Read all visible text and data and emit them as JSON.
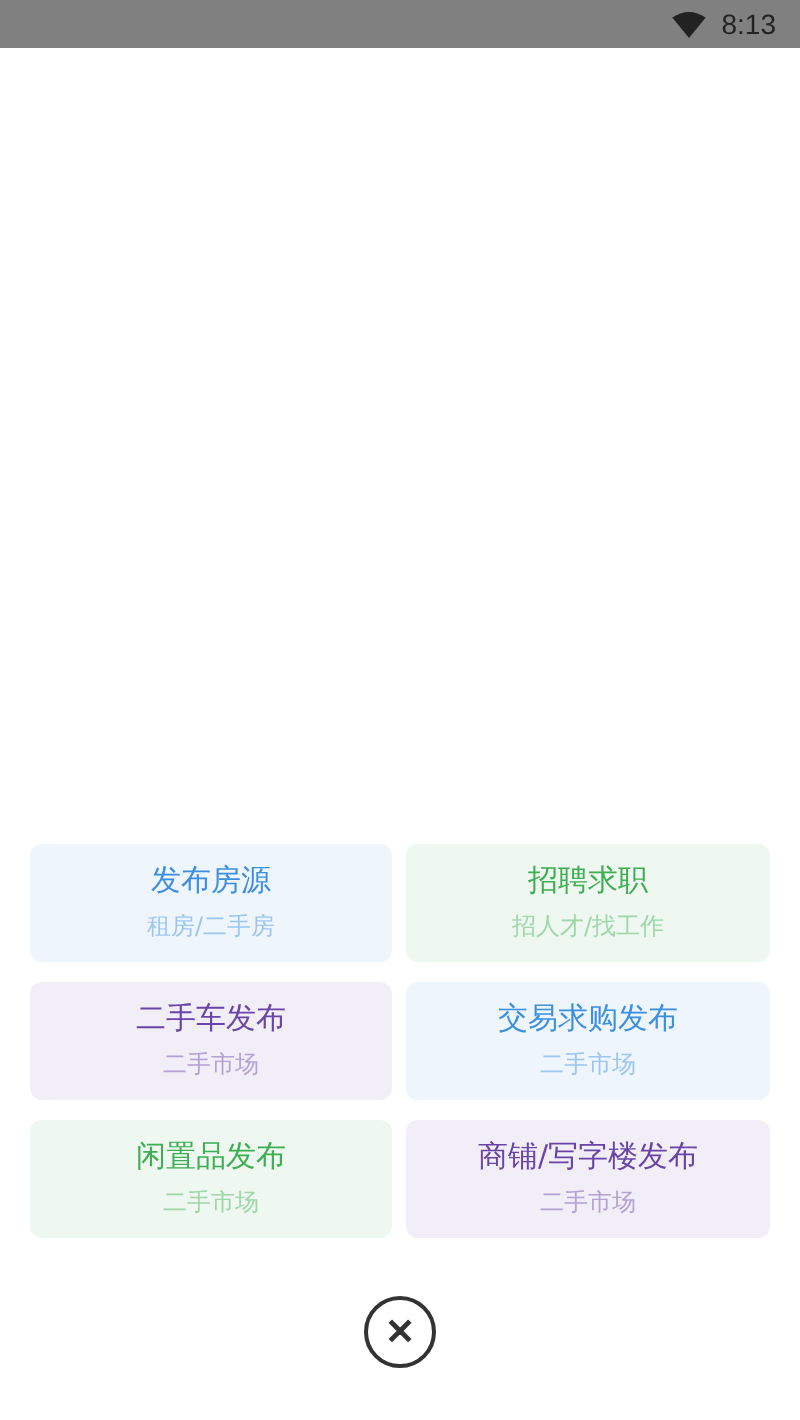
{
  "status_bar": {
    "time": "8:13"
  },
  "options": [
    {
      "title": "发布房源",
      "subtitle": "租房/二手房",
      "color": "#3d8fe0"
    },
    {
      "title": "招聘求职",
      "subtitle": "招人才/找工作",
      "color": "#3fae55"
    },
    {
      "title": "二手车发布",
      "subtitle": "二手市场",
      "color": "#6a45a8"
    },
    {
      "title": "交易求购发布",
      "subtitle": "二手市场",
      "color": "#3d8fe0"
    },
    {
      "title": "闲置品发布",
      "subtitle": "二手市场",
      "color": "#3fae55"
    },
    {
      "title": "商铺/写字楼发布",
      "subtitle": "二手市场",
      "color": "#6a45a8"
    }
  ],
  "close_button": {
    "label": "✕"
  }
}
